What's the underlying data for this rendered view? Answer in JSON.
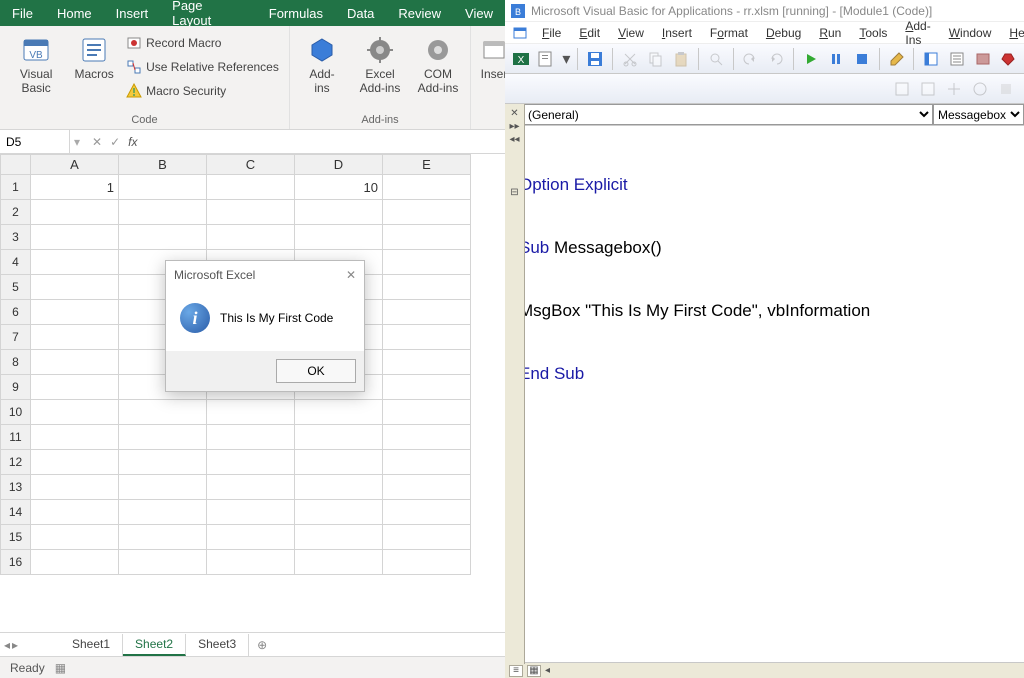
{
  "excel": {
    "tabs": [
      "File",
      "Home",
      "Insert",
      "Page Layout",
      "Formulas",
      "Data",
      "Review",
      "View"
    ],
    "ribbon": {
      "visual_basic": "Visual\nBasic",
      "macros": "Macros",
      "record_macro": "Record Macro",
      "use_relative": "Use Relative References",
      "macro_security": "Macro Security",
      "group_code": "Code",
      "addins": "Add-\nins",
      "excel_addins": "Excel\nAdd-ins",
      "com_addins": "COM\nAdd-ins",
      "group_addins": "Add-ins",
      "insert": "Inser"
    },
    "namebox": "D5",
    "formula": "",
    "columns": [
      "A",
      "B",
      "C",
      "D",
      "E"
    ],
    "rows": 16,
    "cells": {
      "A1": "1",
      "D1": "10"
    },
    "sheets": [
      "Sheet1",
      "Sheet2",
      "Sheet3"
    ],
    "active_sheet": "Sheet2",
    "status": "Ready"
  },
  "msgbox": {
    "title": "Microsoft Excel",
    "text": "This Is My First Code",
    "ok": "OK"
  },
  "vba": {
    "title": "Microsoft Visual Basic for Applications - rr.xlsm [running] - [Module1 (Code)]",
    "menu": [
      "File",
      "Edit",
      "View",
      "Insert",
      "Format",
      "Debug",
      "Run",
      "Tools",
      "Add-Ins",
      "Window",
      "Help"
    ],
    "dropdown_left": "(General)",
    "dropdown_right": "Messagebox",
    "code": {
      "l1a": "Option Explicit",
      "l2a": "Sub",
      "l2b": " Messagebox()",
      "l3": "MsgBox \"This Is My First Code\", vbInformation",
      "l4": "End Sub"
    }
  }
}
